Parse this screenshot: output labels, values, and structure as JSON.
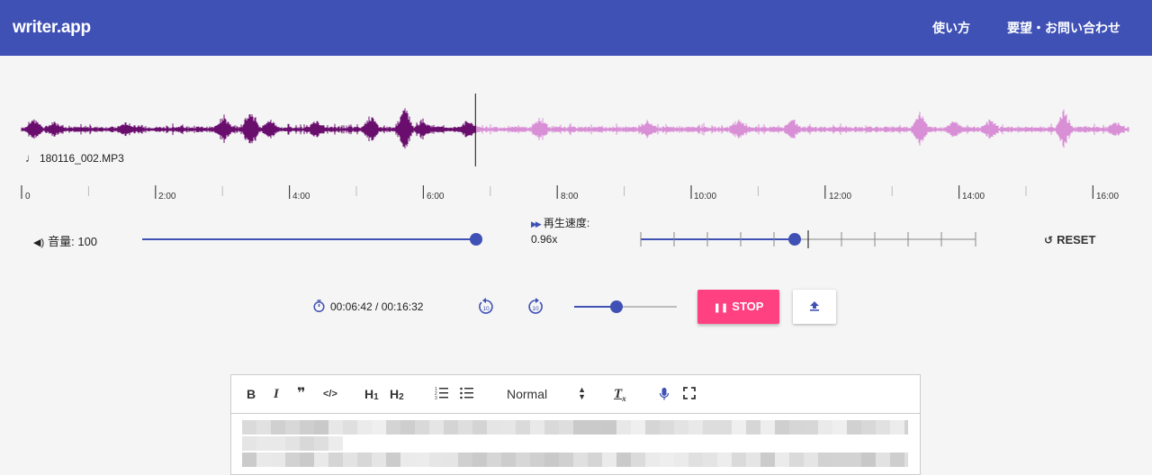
{
  "header": {
    "logo": "writer.app",
    "nav": [
      "使い方",
      "要望・お問い合わせ"
    ]
  },
  "player": {
    "filename": "180116_002.MP3",
    "timeline_labels": [
      "0",
      "2:00",
      "4:00",
      "6:00",
      "8:00",
      "10:00",
      "12:00",
      "14:00",
      "16:00"
    ],
    "progress_fraction": 0.41,
    "volume_label": "音量: 100",
    "volume_value": 100,
    "speed_title": "再生速度:",
    "speed_value": "0.96x",
    "reset_label": "RESET",
    "time_display": "00:06:42 / 00:16:32",
    "skip_back_label": "10",
    "skip_forward_label": "10",
    "stop_label": "STOP",
    "colors": {
      "played": "#6a0e6e",
      "unplayed": "#d98fd6",
      "accent": "#3f51b5",
      "stop": "#ff4081"
    }
  },
  "editor": {
    "toolbar": {
      "bold": "B",
      "italic": "I",
      "quote": "❞",
      "code": "</>",
      "h1": "H",
      "h1_sub": "1",
      "h2": "H",
      "h2_sub": "2",
      "format_value": "Normal",
      "clear": "T",
      "clear_sub": "x"
    }
  }
}
